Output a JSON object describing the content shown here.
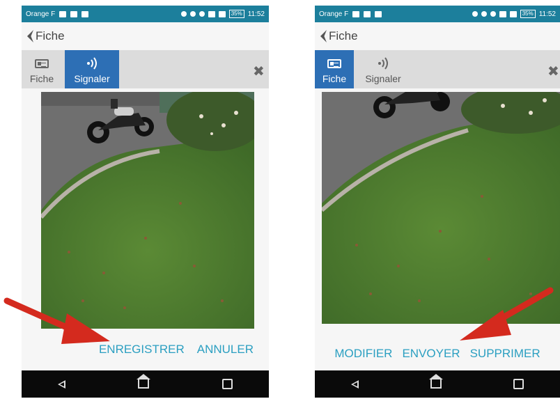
{
  "screens": [
    {
      "status_bar": {
        "carrier": "Orange F",
        "battery": "35%",
        "time": "11:52"
      },
      "header": {
        "title": "Fiche"
      },
      "tabs": [
        {
          "label": "Fiche",
          "icon": "id-card-icon",
          "active": false
        },
        {
          "label": "Signaler",
          "icon": "signal-waves-icon",
          "active": true
        }
      ],
      "close_icon": "close-icon",
      "photo_alt": "",
      "actions": [
        {
          "label": "ENREGISTRER"
        },
        {
          "label": "ANNULER"
        }
      ]
    },
    {
      "status_bar": {
        "carrier": "Orange F",
        "battery": "35%",
        "time": "11:52"
      },
      "header": {
        "title": "Fiche"
      },
      "tabs": [
        {
          "label": "Fiche",
          "icon": "id-card-icon",
          "active": true
        },
        {
          "label": "Signaler",
          "icon": "signal-waves-icon",
          "active": false
        }
      ],
      "close_icon": "close-icon",
      "actions": [
        {
          "label": "MODIFIER"
        },
        {
          "label": "ENVOYER"
        },
        {
          "label": "SUPPRIMER"
        }
      ]
    }
  ],
  "colors": {
    "status_bar": "#1c7f9c",
    "active_tab": "#2d6fb5",
    "action_text": "#2b9fc1",
    "annotation_arrow": "#d42a1e"
  }
}
